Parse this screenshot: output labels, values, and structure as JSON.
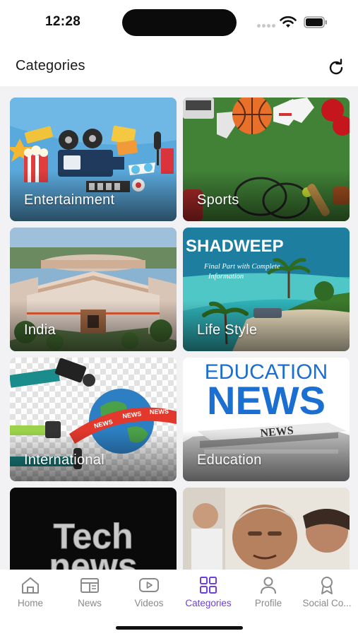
{
  "status": {
    "time": "12:28"
  },
  "header": {
    "title": "Categories",
    "refresh_icon": "refresh-icon"
  },
  "categories": [
    {
      "label": "Entertainment"
    },
    {
      "label": "Sports"
    },
    {
      "label": "India"
    },
    {
      "label": "Life Style"
    },
    {
      "label": "International"
    },
    {
      "label": "Education"
    },
    {
      "label": ""
    },
    {
      "label": ""
    }
  ],
  "art_text": {
    "lifestyle_banner": "SHADWEEP",
    "lifestyle_sub1": "Final Part with Complete",
    "lifestyle_sub2": "Information",
    "education_top": "EDUCATION",
    "education_main": "NEWS",
    "education_paper": "NEWS",
    "intl_news_1": "NEWS",
    "intl_news_2": "NEWS",
    "intl_news_3": "NEWS",
    "tech_1": "Tech",
    "tech_2": "news"
  },
  "nav": {
    "items": [
      {
        "label": "Home",
        "icon": "home-icon"
      },
      {
        "label": "News",
        "icon": "newspaper-icon"
      },
      {
        "label": "Videos",
        "icon": "play-icon"
      },
      {
        "label": "Categories",
        "icon": "grid-icon"
      },
      {
        "label": "Profile",
        "icon": "person-icon"
      },
      {
        "label": "Social Co...",
        "icon": "award-icon"
      }
    ],
    "active_index": 3
  },
  "colors": {
    "accent": "#6c3fe0",
    "inactive": "#8a8a8a"
  }
}
